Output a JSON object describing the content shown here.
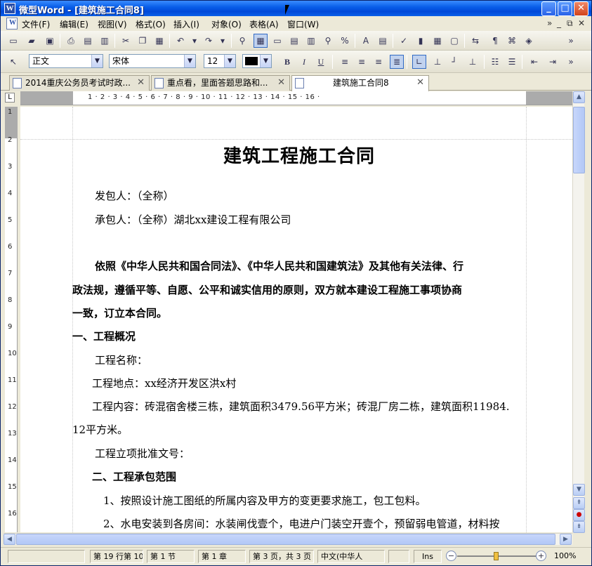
{
  "window": {
    "app_icon": "W",
    "title": "微型Word - [建筑施工合同8]",
    "minimize": "_",
    "maximize": "□",
    "close": "✕"
  },
  "menubar": {
    "items": [
      "文件(F)",
      "编辑(E)",
      "视图(V)",
      "格式(O)",
      "插入(I)",
      "对象(O)",
      "表格(A)",
      "窗口(W)"
    ],
    "overflow": "»",
    "doc_minimize": "_",
    "doc_restore": "⧉",
    "doc_close": "✕"
  },
  "toolbar_format": {
    "style": "正文",
    "font": "宋体",
    "size": "12",
    "bold": "B",
    "italic": "I",
    "underline": "U"
  },
  "tabs": [
    {
      "label": "2014重庆公务员考试时政..."
    },
    {
      "label": "重点看，里面答题思路和..."
    },
    {
      "label": "建筑施工合同8"
    }
  ],
  "ruler": {
    "h_numbers": "1 · 2 · 3 · 4 · 5 · 6 · 7 · 8 · 9 · 10 · 11 · 12 · 13 · 14 · 15 · 16 ·",
    "v_numbers": [
      "1",
      "2",
      "3",
      "4",
      "5",
      "6",
      "7",
      "8",
      "9",
      "10",
      "11",
      "12",
      "13",
      "14",
      "15",
      "16"
    ],
    "corner": "L"
  },
  "document": {
    "title": "建筑工程施工合同",
    "paragraphs": [
      {
        "text": "发包人：（全称）",
        "bold": false
      },
      {
        "text": "承包人：（全称）湖北xx建设工程有限公司",
        "bold": false
      },
      {
        "text": "依照《中华人民共和国合同法》、《中华人民共和国建筑法》及其他有关法律、行",
        "bold": true
      },
      {
        "text": "政法规，遵循平等、自愿、公平和诚实信用的原则，双方就本建设工程施工事项协商",
        "bold": true
      },
      {
        "text": "一致，订立本合同。",
        "bold": true
      },
      {
        "text": "一、工程概况",
        "bold": true
      },
      {
        "text": "工程名称：",
        "bold": false
      },
      {
        "text": "工程地点：xx经济开发区洪x村",
        "bold": false
      },
      {
        "text": "工程内容：砖混宿舍楼三栋，建筑面积3479.56平方米；砖混厂房二栋，建筑面积11984.",
        "bold": false
      },
      {
        "text": "12平方米。",
        "bold": false
      },
      {
        "text": "工程立项批准文号：",
        "bold": false
      },
      {
        "text": "二、工程承包范围",
        "bold": true
      },
      {
        "text": "1、按照设计施工图纸的所属内容及甲方的变更要求施工，包工包料。",
        "bold": false
      },
      {
        "text": "2、水电安装到各房间：水装闸伐壹个，电进户门装空开壹个，预留弱电管道，材料按",
        "bold": false
      }
    ]
  },
  "statusbar": {
    "row_col": "第 19 行第 10",
    "section": "第 1 节",
    "chapter": "第 1 章",
    "page": "第 3 页，共 3 页",
    "language": "中文(中华人",
    "mode": "Ins",
    "zoom_minus": "−",
    "zoom_plus": "+",
    "zoom": "100%",
    "zoom_level_percent": 100
  }
}
